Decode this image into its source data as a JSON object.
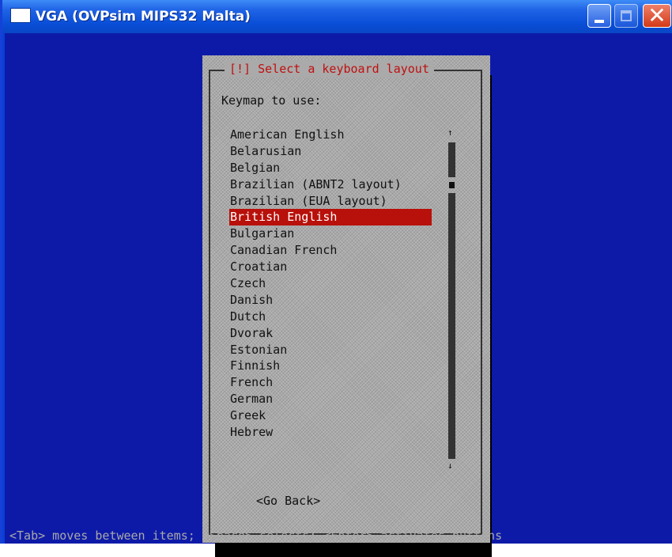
{
  "window": {
    "title": "VGA (OVPsim MIPS32 Malta)",
    "buttons": {
      "minimize": "minimize-icon",
      "maximize": "maximize-icon",
      "close": "close-icon"
    }
  },
  "dialog": {
    "title": "[!] Select a keyboard layout",
    "prompt": "Keymap to use:",
    "items": [
      "American English",
      "Belarusian",
      "Belgian",
      "Brazilian (ABNT2 layout)",
      "Brazilian (EUA layout)",
      "British English",
      "Bulgarian",
      "Canadian French",
      "Croatian",
      "Czech",
      "Danish",
      "Dutch",
      "Dvorak",
      "Estonian",
      "Finnish",
      "French",
      "German",
      "Greek",
      "Hebrew"
    ],
    "selected_item": "British English",
    "scroll_up_glyph": "↑",
    "scroll_down_glyph": "↓",
    "go_back_label": "<Go Back>"
  },
  "status": {
    "hint": "<Tab> moves between items; <Space> selects; <Enter> activates buttons"
  },
  "colors": {
    "screen_bg": "#0d1aa8",
    "dialog_bg": "#aaaaaa",
    "selection_bg": "#b8100a",
    "title_red": "#c01010"
  }
}
